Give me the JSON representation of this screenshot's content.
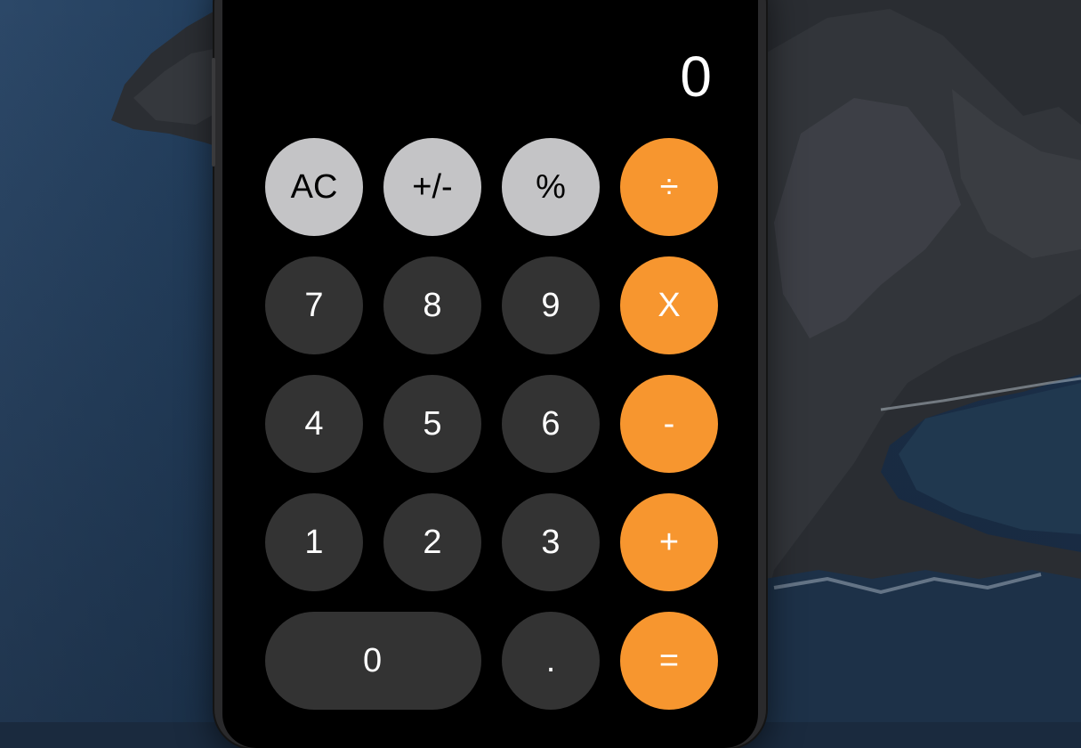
{
  "display": {
    "value": "0"
  },
  "keys": {
    "clear": "AC",
    "negate": "+/-",
    "percent": "%",
    "divide": "÷",
    "seven": "7",
    "eight": "8",
    "nine": "9",
    "multiply": "X",
    "four": "4",
    "five": "5",
    "six": "6",
    "minus": "-",
    "one": "1",
    "two": "2",
    "three": "3",
    "plus": "+",
    "zero": "0",
    "decimal": ".",
    "equals": "="
  },
  "colors": {
    "operator": "#f7962f",
    "function": "#c4c4c6",
    "digit": "#333333",
    "screen": "#000000"
  }
}
